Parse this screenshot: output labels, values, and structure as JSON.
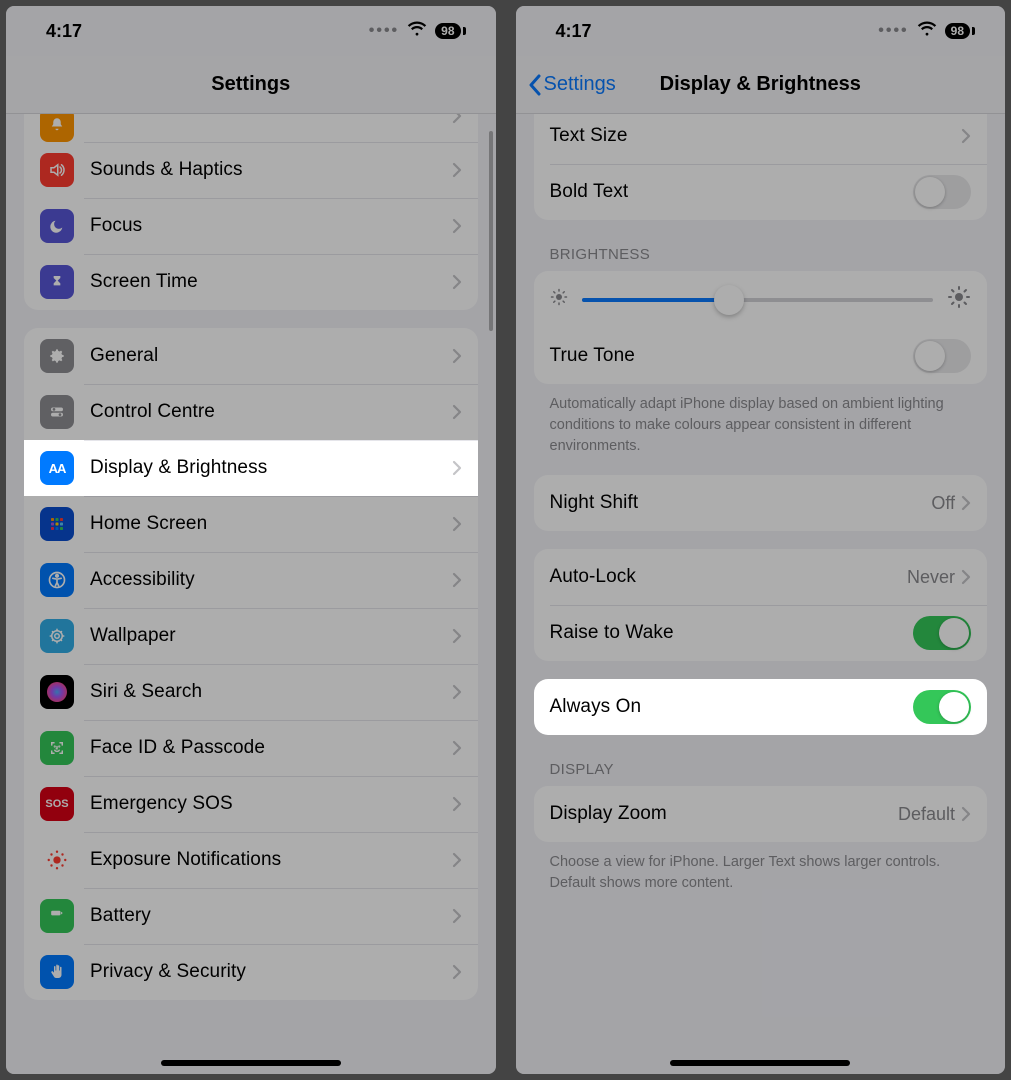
{
  "status": {
    "time": "4:17",
    "battery": "98"
  },
  "left": {
    "title": "Settings",
    "groups": [
      {
        "partialTop": true,
        "rows": [
          {
            "icon": "bell-icon",
            "ic": "ic-orange",
            "label": "Notifications"
          },
          {
            "icon": "sound-icon",
            "ic": "ic-red",
            "label": "Sounds & Haptics"
          },
          {
            "icon": "moon-icon",
            "ic": "ic-purple",
            "label": "Focus"
          },
          {
            "icon": "hourglass-icon",
            "ic": "ic-purple",
            "label": "Screen Time"
          }
        ]
      },
      {
        "rows": [
          {
            "icon": "gear-icon",
            "ic": "ic-gray",
            "label": "General"
          },
          {
            "icon": "switches-icon",
            "ic": "ic-gray",
            "label": "Control Centre"
          },
          {
            "icon": "text-size-icon",
            "ic": "ic-blue",
            "label": "Display & Brightness",
            "highlight": true
          },
          {
            "icon": "grid-icon",
            "ic": "ic-dblue",
            "label": "Home Screen"
          },
          {
            "icon": "accessibility-icon",
            "ic": "ic-blue",
            "label": "Accessibility"
          },
          {
            "icon": "wallpaper-icon",
            "ic": "ic-teal",
            "label": "Wallpaper"
          },
          {
            "icon": "siri-icon",
            "ic": "ic-black",
            "label": "Siri & Search"
          },
          {
            "icon": "faceid-icon",
            "ic": "ic-green",
            "label": "Face ID & Passcode"
          },
          {
            "icon": "sos-icon",
            "ic": "ic-dred",
            "label": "Emergency SOS"
          },
          {
            "icon": "exposure-icon",
            "ic": "ic-pink",
            "label": "Exposure Notifications"
          },
          {
            "icon": "battery-icon",
            "ic": "ic-green",
            "label": "Battery"
          },
          {
            "icon": "hand-icon",
            "ic": "ic-blue",
            "label": "Privacy & Security"
          }
        ]
      }
    ]
  },
  "right": {
    "backLabel": "Settings",
    "title": "Display & Brightness",
    "topGroup": {
      "rows": [
        {
          "label": "Text Size",
          "chevron": true
        },
        {
          "label": "Bold Text",
          "toggle": "off"
        }
      ]
    },
    "brightness": {
      "header": "Brightness",
      "sliderPercent": 42,
      "trueTone": {
        "label": "True Tone",
        "toggle": "off"
      },
      "footer": "Automatically adapt iPhone display based on ambient lighting conditions to make colours appear consistent in different environments."
    },
    "nightShift": {
      "label": "Night Shift",
      "value": "Off"
    },
    "autoGroup": {
      "rows": [
        {
          "label": "Auto-Lock",
          "value": "Never",
          "chevron": true
        },
        {
          "label": "Raise to Wake",
          "toggle": "on"
        }
      ]
    },
    "alwaysOn": {
      "label": "Always On",
      "toggle": "on",
      "highlight": true
    },
    "display": {
      "header": "Display",
      "row": {
        "label": "Display Zoom",
        "value": "Default",
        "chevron": true
      },
      "footer": "Choose a view for iPhone. Larger Text shows larger controls. Default shows more content."
    }
  }
}
